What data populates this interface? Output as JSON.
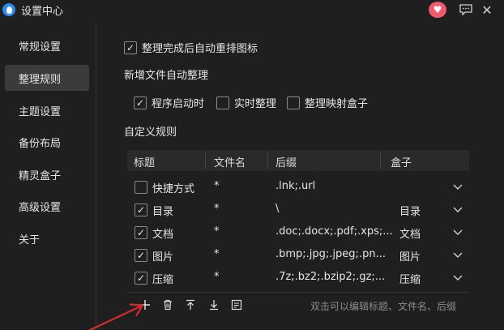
{
  "window": {
    "title": "设置中心"
  },
  "sidebar": {
    "items": [
      {
        "label": "常规设置"
      },
      {
        "label": "整理规则"
      },
      {
        "label": "主题设置"
      },
      {
        "label": "备份布局"
      },
      {
        "label": "精灵盒子"
      },
      {
        "label": "高级设置"
      },
      {
        "label": "关于"
      }
    ],
    "active_index": 1
  },
  "main": {
    "auto_arrange": {
      "label": "整理完成后自动重排图标",
      "checked": true
    },
    "new_file_section": "新增文件自动整理",
    "options": [
      {
        "label": "程序启动时",
        "checked": true
      },
      {
        "label": "实时整理",
        "checked": false
      },
      {
        "label": "整理映射盒子",
        "checked": false
      }
    ],
    "custom_rules_section": "自定义规则",
    "table": {
      "headers": [
        "标题",
        "文件名",
        "后缀",
        "盒子"
      ],
      "rows": [
        {
          "checked": false,
          "title": "快捷方式",
          "filename": "*",
          "suffix": ".lnk;.url",
          "box": ""
        },
        {
          "checked": true,
          "title": "目录",
          "filename": "*",
          "suffix": "\\",
          "box": "目录"
        },
        {
          "checked": true,
          "title": "文档",
          "filename": "*",
          "suffix": ".doc;.docx;.pdf;.xps;...",
          "box": "文档"
        },
        {
          "checked": true,
          "title": "图片",
          "filename": "*",
          "suffix": ".bmp;.jpg;.jpeg;.pn...",
          "box": "图片"
        },
        {
          "checked": true,
          "title": "压缩",
          "filename": "*",
          "suffix": ".7z;.bz2;.bzip2;.gz;...",
          "box": "压缩"
        }
      ]
    },
    "hint": "双击可以编辑标题、文件名、后缀"
  },
  "icons": {
    "heart": "heart-icon",
    "feedback": "feedback-icon",
    "close": "close-icon",
    "add": "add-icon",
    "delete": "delete-icon",
    "move_up": "move-up-icon",
    "move_down": "move-down-icon",
    "import": "import-icon"
  },
  "colors": {
    "background": "#1f1f1f",
    "active_item": "#3b3b3b",
    "heart": "#f05a6e",
    "logo": "#2a8cf0",
    "arrow": "#d92b2b"
  }
}
